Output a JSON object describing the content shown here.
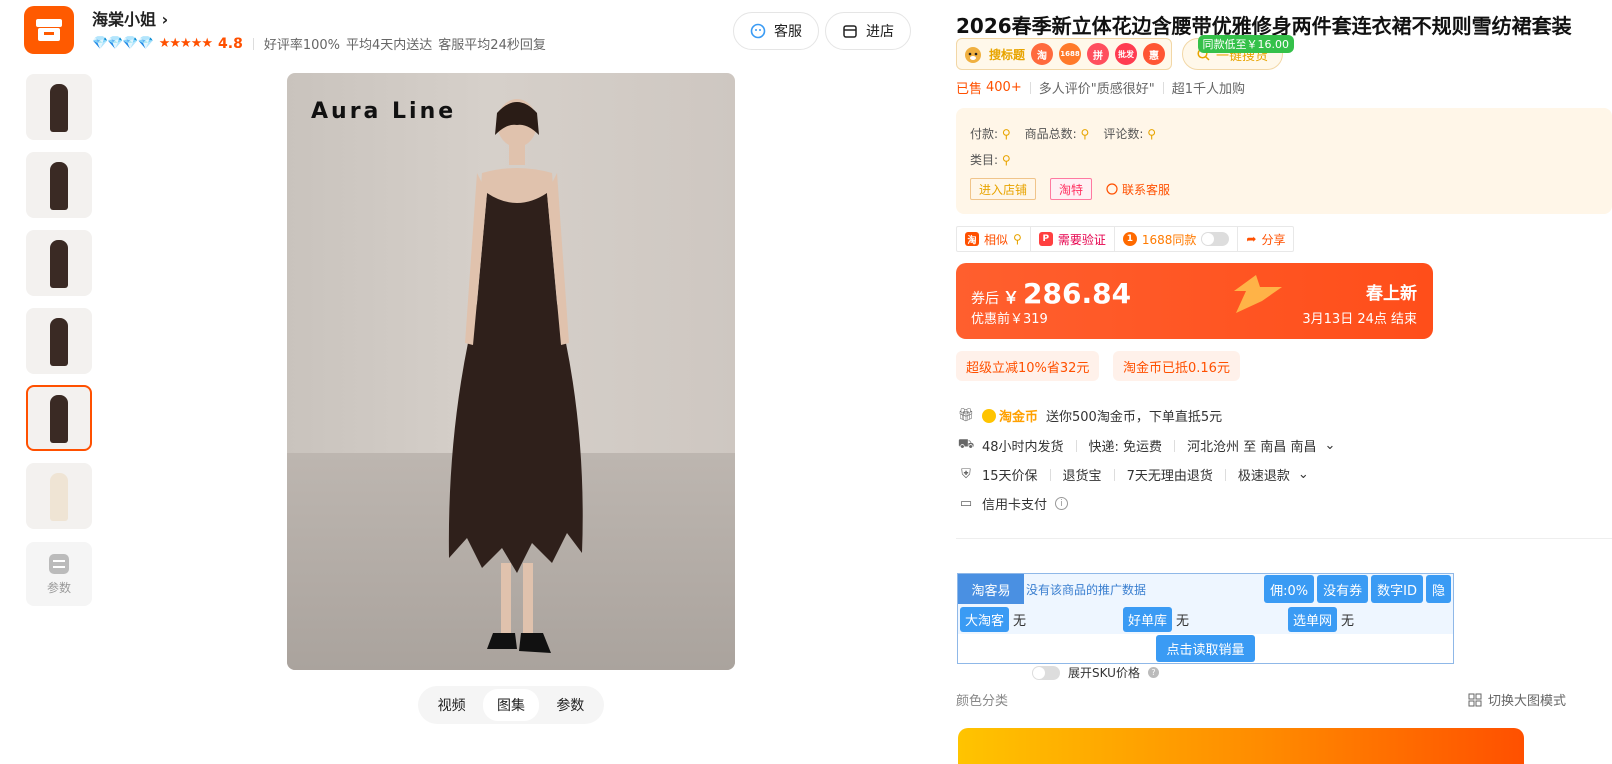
{
  "shop": {
    "name": "海棠小姐",
    "arrow": "›",
    "diamonds": "💎💎💎💎",
    "stars": "★★★★★",
    "rating": "4.8",
    "good_rate": "好评率100%",
    "delivery": "平均4天内送达",
    "reply": "客服平均24秒回复",
    "service_btn": "客服",
    "enter_btn": "进店"
  },
  "gallery": {
    "brand_text": "Aura  Line",
    "param_label": "参数",
    "tabs": [
      "视频",
      "图集",
      "参数"
    ],
    "active_tab": "图集"
  },
  "product": {
    "title": "2026春季新立体花边含腰带优雅修身两件套连衣裙不规则雪纺裙套装",
    "plugin_label": "搜标题",
    "plugin_icons": [
      "淘",
      "1688",
      "拼",
      "批发",
      "惠"
    ],
    "search_goods": "一键搜货",
    "low_badge": "同款低至￥16.00",
    "sold_prefix": "已售",
    "sold_count": "400+",
    "review": "多人评价\"质感很好\"",
    "cart": "超1千人加购"
  },
  "info_box": {
    "pay": "付款:",
    "total": "商品总数:",
    "comments": "评论数:",
    "category": "类目:",
    "enter_shop": "进入店铺",
    "taote": "淘特",
    "contact": "联系客服"
  },
  "tools": {
    "similar": "相似",
    "verify": "需要验证",
    "same_1688": "1688同款",
    "share": "分享"
  },
  "price": {
    "after_label": "券后",
    "currency": "￥",
    "amount": "286.84",
    "before": "优惠前￥319",
    "promo": "春上新",
    "end": "3月13日 24点  结束"
  },
  "coupons": [
    "超级立减10%省32元",
    "淘金币已抵0.16元"
  ],
  "services": {
    "coin_brand": "淘金币",
    "coin_text": "送你500淘金币，下单直抵5元",
    "ship_time": "48小时内发货",
    "ship_fee": "快递: 免运费",
    "ship_route": "河北沧州 至 南昌 南昌",
    "guarantee": "15天价保",
    "return_ins": "退货宝",
    "no_reason": "7天无理由退货",
    "fast_refund": "极速退款",
    "credit": "信用卡支付"
  },
  "taokeyi": {
    "brand": "淘客易",
    "no_data": "没有该商品的推广数据",
    "commission": "佣:0%",
    "no_coupon": "没有券",
    "digital_id": "数字ID",
    "hide": "隐",
    "dataoke": "大淘客",
    "dataoke_val": "无",
    "haodanku": "好单库",
    "haodanku_val": "无",
    "xuandan": "选单网",
    "xuandan_val": "无",
    "read_sales": "点击读取销量"
  },
  "sku": {
    "expand": "展开SKU价格",
    "color_label": "颜色分类",
    "switch_mode": "切换大图模式"
  },
  "colors": {
    "accent": "#ff5000",
    "shop_logo": "#ff5a00",
    "blue": "#3a9bf4"
  }
}
